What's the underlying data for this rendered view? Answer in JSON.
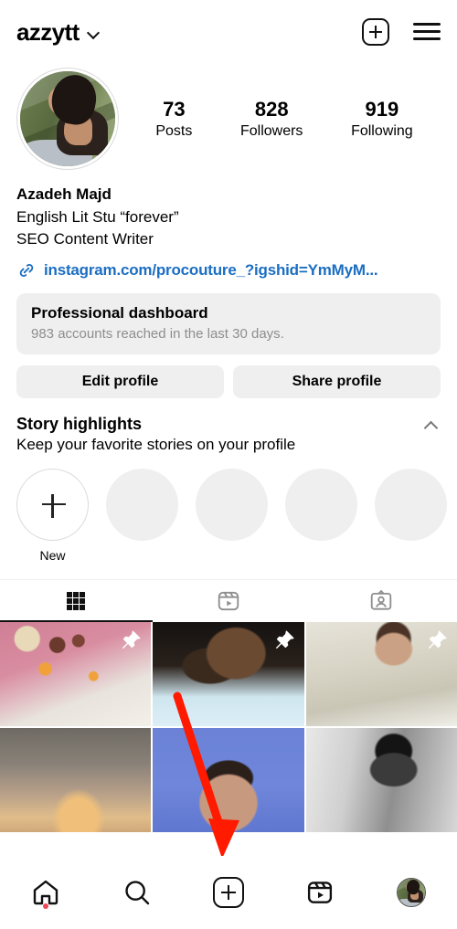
{
  "header": {
    "username": "azzytt",
    "chevron_icon": "chevron-down-icon",
    "create_icon": "plus-square-icon",
    "menu_icon": "hamburger-menu-icon"
  },
  "profile": {
    "avatar_icon": "profile-avatar",
    "stats": [
      {
        "value": "73",
        "label": "Posts"
      },
      {
        "value": "828",
        "label": "Followers"
      },
      {
        "value": "919",
        "label": "Following"
      }
    ],
    "display_name": "Azadeh Majd",
    "bio_lines": [
      "English Lit Stu “forever”",
      "SEO Content Writer"
    ],
    "link": {
      "icon": "link-chain-icon",
      "text": "instagram.com/procouture_?igshid=YmMyM...",
      "color": "#1b6ec2"
    }
  },
  "dashboard": {
    "title": "Professional dashboard",
    "subtitle": "983 accounts reached in the last 30 days."
  },
  "actions": {
    "edit_profile": "Edit profile",
    "share_profile": "Share profile"
  },
  "story_highlights": {
    "title": "Story highlights",
    "subtitle": "Keep your favorite stories on your profile",
    "collapse_icon": "chevron-up-icon",
    "new_label": "New",
    "new_icon": "plus-icon",
    "placeholder_count": 4,
    "placeholder_color": "#efefef"
  },
  "tabs": [
    {
      "name": "grid",
      "icon": "grid-icon",
      "active": true
    },
    {
      "name": "reels",
      "icon": "reels-icon",
      "active": false
    },
    {
      "name": "tagged",
      "icon": "tagged-person-icon",
      "active": false
    }
  ],
  "grid": {
    "posts": [
      {
        "style": "ph-picnic",
        "pinned": true,
        "alt": "picnic blanket with pastries"
      },
      {
        "style": "ph-curly",
        "pinned": true,
        "alt": "woman with curly hair in white top"
      },
      {
        "style": "ph-blazer",
        "pinned": true,
        "alt": "woman in beige blazer"
      },
      {
        "style": "ph-sunset",
        "pinned": false,
        "alt": "cloudy sunset with silhouette"
      },
      {
        "style": "ph-blue",
        "pinned": false,
        "alt": "portrait against blue sky"
      },
      {
        "style": "ph-bw",
        "pinned": false,
        "alt": "black and white portrait"
      }
    ],
    "pin_icon": "pushpin-icon"
  },
  "annotation": {
    "arrow_color": "#ff1a00",
    "points_to": "create-post-button"
  },
  "bottom_nav": {
    "items": [
      {
        "name": "home",
        "icon": "home-icon",
        "badge": true
      },
      {
        "name": "search",
        "icon": "search-icon",
        "badge": false
      },
      {
        "name": "create",
        "icon": "plus-square-icon",
        "badge": false
      },
      {
        "name": "reels",
        "icon": "reels-icon",
        "badge": false
      },
      {
        "name": "profile",
        "icon": "avatar-icon",
        "badge": false
      }
    ],
    "badge_color": "#ed4956"
  }
}
